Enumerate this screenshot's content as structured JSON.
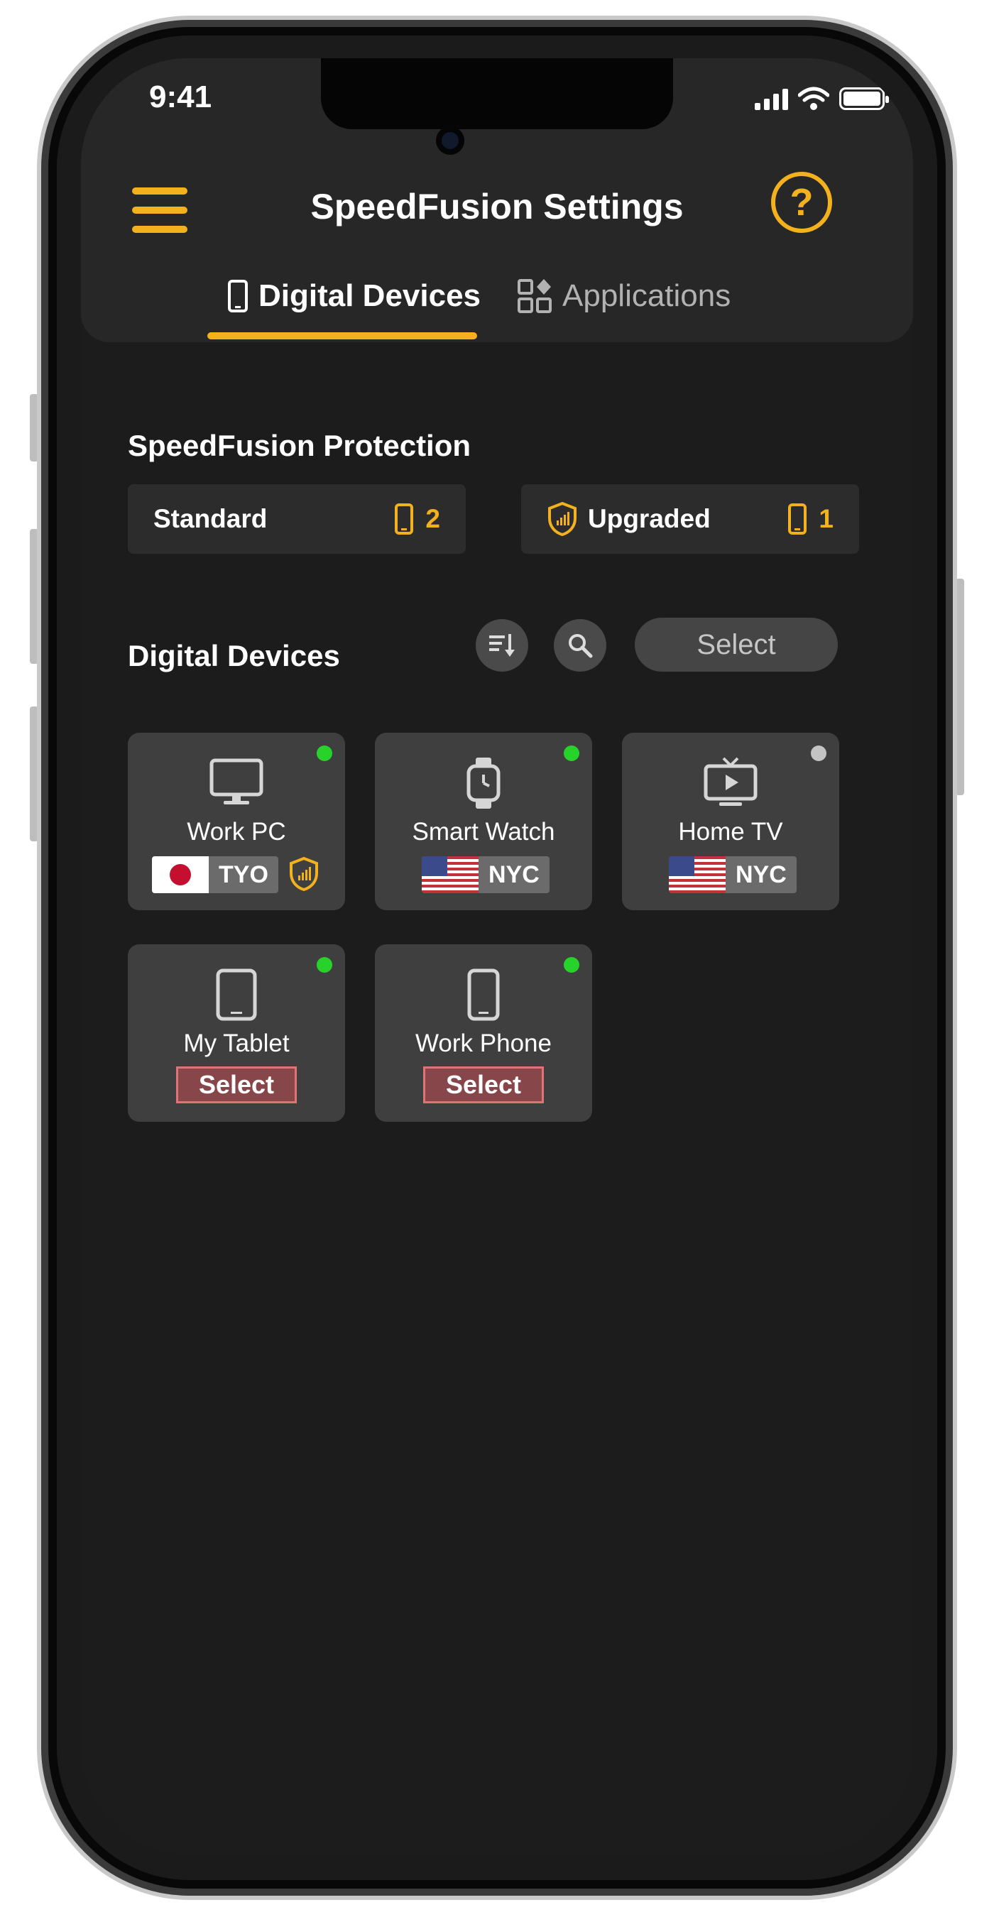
{
  "status": {
    "time": "9:41"
  },
  "header": {
    "title": "SpeedFusion Settings",
    "help_glyph": "?"
  },
  "tabs": [
    {
      "label": "Digital Devices",
      "icon": "phone-icon",
      "active": true
    },
    {
      "label": "Applications",
      "icon": "apps-icon",
      "active": false
    }
  ],
  "protection": {
    "title": "SpeedFusion Protection",
    "standard": {
      "label": "Standard",
      "count": "2"
    },
    "upgraded": {
      "label": "Upgraded",
      "count": "1"
    }
  },
  "devices_section": {
    "title": "Digital Devices",
    "select_label": "Select"
  },
  "devices": [
    {
      "name": "Work PC",
      "status": "online",
      "location": "TYO",
      "flag": "jp",
      "upgraded": true
    },
    {
      "name": "Smart Watch",
      "status": "online",
      "location": "NYC",
      "flag": "us"
    },
    {
      "name": "Home TV",
      "status": "offline",
      "location": "NYC",
      "flag": "us"
    },
    {
      "name": "My Tablet",
      "status": "online",
      "action": "Select"
    },
    {
      "name": "Work Phone",
      "status": "online",
      "action": "Select"
    }
  ],
  "colors": {
    "accent": "#f3b21d",
    "online": "#27d32b",
    "offline": "#c4c4c4",
    "background": "#1c1c1c"
  }
}
